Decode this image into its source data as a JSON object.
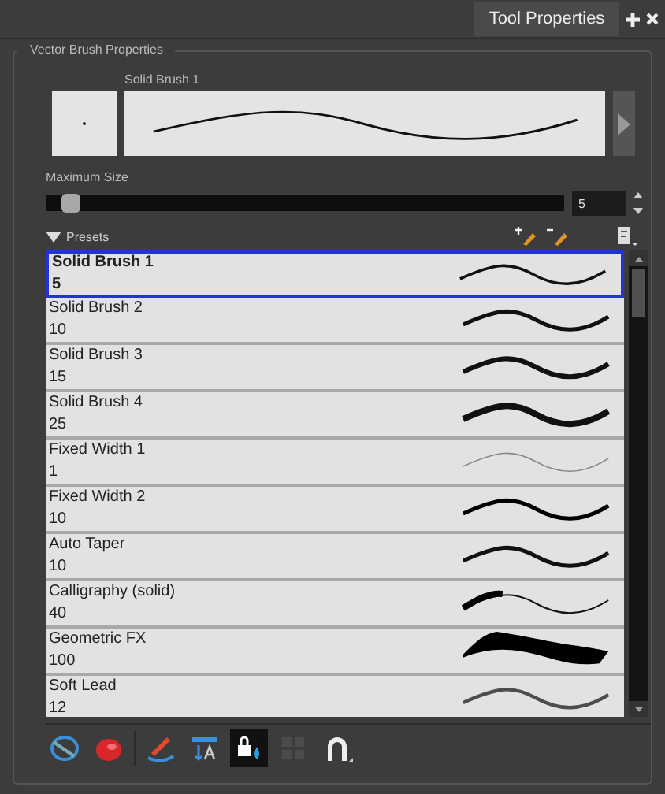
{
  "panel_tab": {
    "title": "Tool Properties",
    "selected": true
  },
  "group": {
    "title": "Vector Brush Properties"
  },
  "preview": {
    "title": "Solid Brush 1"
  },
  "maximum_size": {
    "label": "Maximum Size",
    "level": 0.02,
    "value": "5"
  },
  "presets": {
    "label": "Presets",
    "expanded": true
  },
  "preset_list": [
    {
      "name": "Solid Brush 1",
      "size": "5",
      "kind": "tapered",
      "selected": true
    },
    {
      "name": "Solid Brush 2",
      "size": "10",
      "kind": "tapered",
      "selected": false
    },
    {
      "name": "Solid Brush 3",
      "size": "15",
      "kind": "tapered",
      "selected": false
    },
    {
      "name": "Solid Brush 4",
      "size": "25",
      "kind": "tapered",
      "selected": false
    },
    {
      "name": "Fixed Width 1",
      "size": "1",
      "kind": "fixed",
      "selected": false
    },
    {
      "name": "Fixed Width 2",
      "size": "10",
      "kind": "fixed",
      "selected": false
    },
    {
      "name": "Auto Taper",
      "size": "10",
      "kind": "tapered",
      "selected": false
    },
    {
      "name": "Calligraphy (solid)",
      "size": "40",
      "kind": "calligraphy",
      "selected": false
    },
    {
      "name": "Geometric FX",
      "size": "100",
      "kind": "geometric",
      "selected": false
    },
    {
      "name": "Soft Lead",
      "size": "12",
      "kind": "soft",
      "selected": false
    }
  ],
  "toolbar": [
    {
      "kind": "contour",
      "selected": false,
      "disabled": false
    },
    {
      "kind": "ellipse",
      "selected": false,
      "disabled": false
    },
    {
      "kind": "brush",
      "selected": false,
      "disabled": false
    },
    {
      "kind": "text",
      "selected": false,
      "disabled": false
    },
    {
      "kind": "lock",
      "selected": true,
      "disabled": false
    },
    {
      "kind": "grid",
      "selected": false,
      "disabled": true
    },
    {
      "kind": "magnet",
      "selected": false,
      "disabled": false
    }
  ]
}
